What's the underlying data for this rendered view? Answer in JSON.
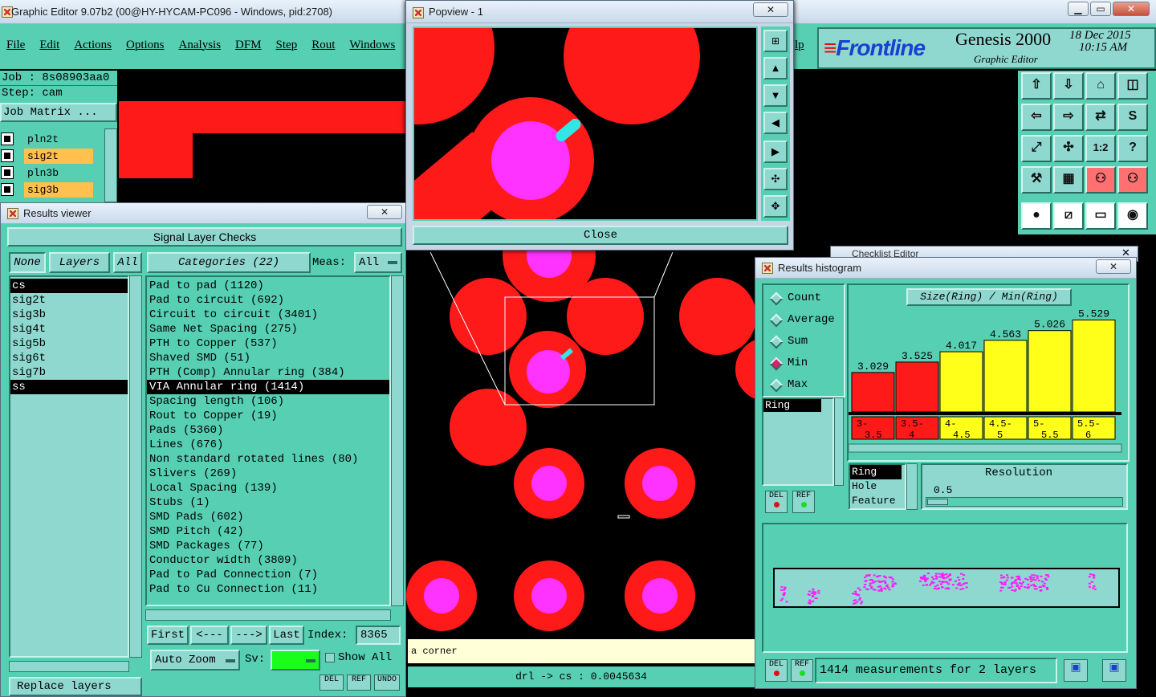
{
  "app": {
    "title": "Graphic Editor 9.07b2 (00@HY-HYCAM-PC096 - Windows, pid:2708)",
    "menu": [
      "File",
      "Edit",
      "Actions",
      "Options",
      "Analysis",
      "DFM",
      "Step",
      "Rout",
      "Windows"
    ],
    "help_partial": "lp",
    "job_label": "Job : 8s08903aa0",
    "step_label": "Step: cam",
    "job_matrix_label": "Job Matrix ...",
    "layers": [
      {
        "name": "pln2t",
        "color": "#57cfb3"
      },
      {
        "name": "sig2t",
        "color": "#ffc04d"
      },
      {
        "name": "pln3b",
        "color": "#57cfb3"
      },
      {
        "name": "sig3b",
        "color": "#ffc04d"
      }
    ],
    "brand": "Frontline",
    "product": "Genesis 2000",
    "product_sub": "Graphic Editor",
    "date": "18 Dec 2015",
    "time": "10:15 AM",
    "coord_readout": "drl -> cs : 0.0045634",
    "hint_text": "a corner",
    "bottom_buttons": [
      "DEL",
      "REF",
      "UNDO"
    ]
  },
  "popview": {
    "title": "Popview - 1",
    "close_label": "Close"
  },
  "results_viewer": {
    "title": "Results viewer",
    "header": "Signal Layer Checks",
    "filter_buttons": [
      "None",
      "Layers",
      "All"
    ],
    "categories_label": "Categories (22)",
    "meas_label": "Meas:",
    "meas_value": "All",
    "layer_list": [
      "cs",
      "sig2t",
      "sig3b",
      "sig4t",
      "sig5b",
      "sig6t",
      "sig7b",
      "ss"
    ],
    "selected_layers": [
      "cs",
      "ss"
    ],
    "categories": [
      "Pad to pad (1120)",
      "Pad to circuit (692)",
      "Circuit to circuit (3401)",
      "Same Net Spacing (275)",
      "PTH to Copper (537)",
      "Shaved SMD (51)",
      "PTH (Comp) Annular ring (384)",
      "VIA Annular ring (1414)",
      "Spacing length (106)",
      "Rout to Copper (19)",
      "Pads (5360)",
      "Lines (676)",
      "Non standard rotated lines (80)",
      "Slivers (269)",
      "Local Spacing (139)",
      "Stubs (1)",
      "SMD Pads (602)",
      "SMD Pitch (42)",
      "SMD Packages (77)",
      "Conductor width (3809)",
      "Pad to Pad Connection (7)",
      "Pad to Cu Connection (11)"
    ],
    "selected_category": "VIA Annular ring (1414)",
    "nav": {
      "first": "First",
      "prev": "<---",
      "next": "--->",
      "last": "Last",
      "index_label": "Index:",
      "index_value": "8365"
    },
    "auto_zoom": "Auto Zoom",
    "sv_label": "Sv:",
    "show_all": "Show All",
    "replace_layers": "Replace layers"
  },
  "histogram": {
    "title": "Results histogram",
    "behind_title": "Checklist Editor",
    "modes": [
      "Count",
      "Average",
      "Sum",
      "Min",
      "Max"
    ],
    "selected_mode": "Min",
    "chart_title": "Size(Ring) / Min(Ring)",
    "ring_field": "Ring",
    "measures": [
      "Ring",
      "Hole",
      "Feature"
    ],
    "selected_measure": "Ring",
    "resolution_label": "Resolution",
    "resolution_value": "0.5",
    "del": "DEL",
    "ref": "REF",
    "status": "1414 measurements for 2 layers"
  },
  "chart_data": {
    "type": "bar",
    "title": "Size(Ring) / Min(Ring)",
    "categories": [
      "3-3.5",
      "3.5-4",
      "4-4.5",
      "4.5-5",
      "5-5.5",
      "5.5-6"
    ],
    "values": [
      3.029,
      3.525,
      4.017,
      4.563,
      5.026,
      5.529
    ],
    "bar_colors": [
      "#ff1a1a",
      "#ff1a1a",
      "#ffff1a",
      "#ffff1a",
      "#ffff1a",
      "#ffff1a"
    ],
    "xlabel": "",
    "ylabel": ""
  }
}
